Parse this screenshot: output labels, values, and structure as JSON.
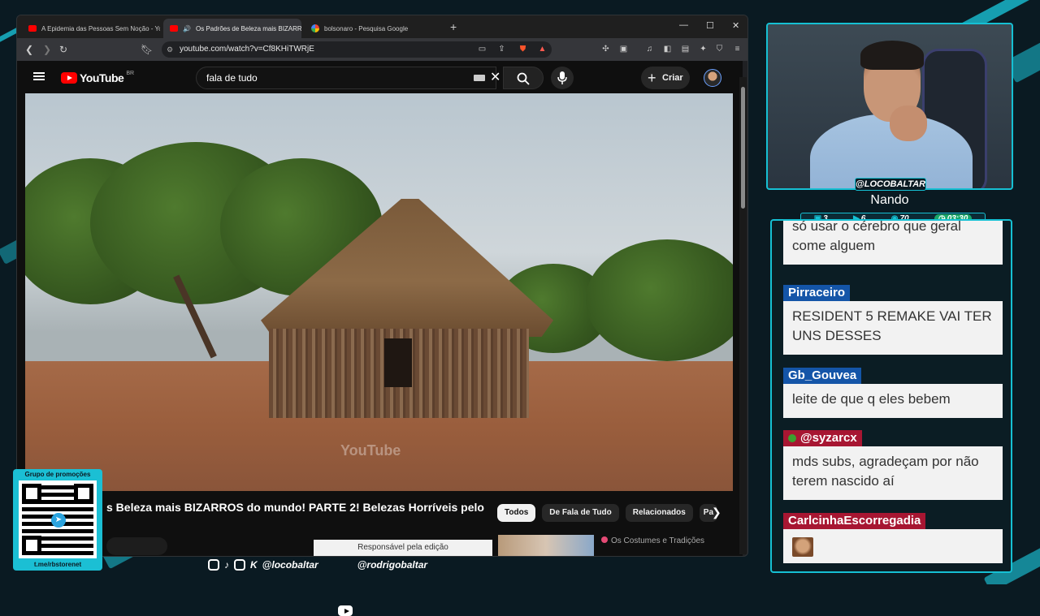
{
  "browser": {
    "tabs": [
      {
        "title": "A Epidemia das Pessoas Sem Noção - YouTube"
      },
      {
        "title": "Os Padrões de Beleza mais BIZARROS"
      },
      {
        "title": "bolsonaro - Pesquisa Google"
      }
    ],
    "url": "youtube.com/watch?v=Cf8KHiTWRjE"
  },
  "youtube": {
    "logo": "YouTube",
    "country": "BR",
    "search_value": "fala de tudo",
    "create_label": "Criar",
    "watermark": "YouTube",
    "video_title": "s Beleza mais BIZARROS do mundo! PARTE 2! Belezas Horríveis pelo",
    "chips": [
      "Todos",
      "De Fala de Tudo",
      "Relacionados",
      "Pa"
    ],
    "credit": "Responsável pela edição",
    "related_title": "Os Costumes e Tradições"
  },
  "stream": {
    "channel_tag": "@LOCOBALTAR",
    "name": "Nando",
    "stats": {
      "chat": "3",
      "video": "6",
      "viewers": "70",
      "timer": "03:30"
    },
    "social": {
      "handle1": "@locobaltar",
      "handle2": "@rodrigobaltar"
    },
    "promo": {
      "label": "Grupo de promoções",
      "url": "t.me/rbstorenet"
    }
  },
  "chat": [
    {
      "user": "",
      "text": "só usar o cérebro que geral come alguem"
    },
    {
      "user": "Pirraceiro",
      "text": "RESIDENT 5 REMAKE VAI TER UNS DESSES"
    },
    {
      "user": "Gb_Gouvea",
      "text": "leite de que q eles bebem"
    },
    {
      "user": "@syzarcx",
      "text": "mds subs, agradeçam por não terem nascido aí"
    },
    {
      "user": "CarlcinhaEscorregadia",
      "text": ""
    }
  ],
  "colors": {
    "accent": "#16c0d3",
    "youtube_red": "#ff0000",
    "chat_blue": "#1455a8",
    "chat_red": "#a71632"
  }
}
